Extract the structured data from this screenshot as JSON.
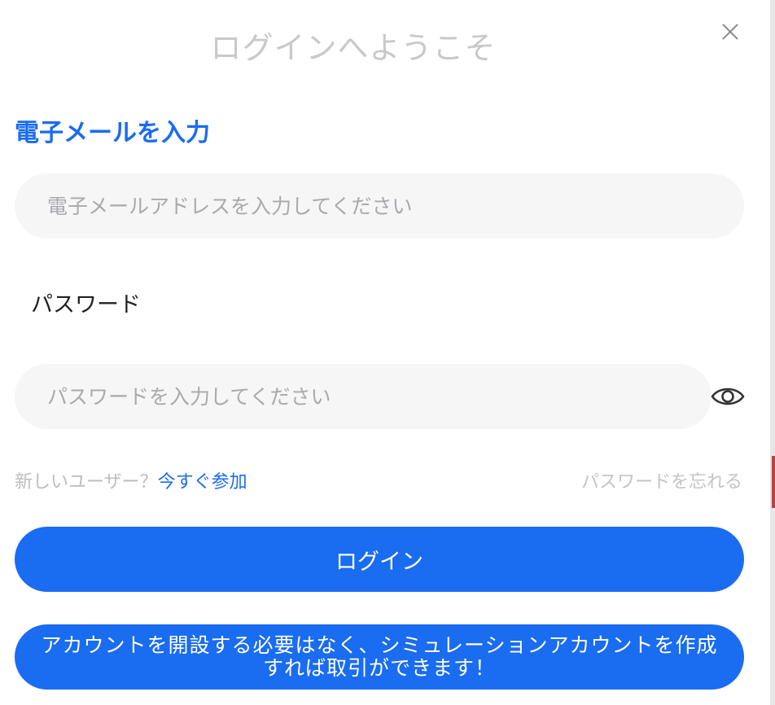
{
  "modal": {
    "title": "ログインへようこそ",
    "close_icon": "close-icon"
  },
  "email_section": {
    "heading": "電子メールを入力",
    "placeholder": "電子メールアドレスを入力してください",
    "value": ""
  },
  "password_section": {
    "label": "パスワード",
    "placeholder": "パスワードを入力してください",
    "value": "",
    "toggle_icon": "eye-icon"
  },
  "links": {
    "new_user_prompt": "新しいユーザー？",
    "join_now": "今すぐ参加",
    "forgot_password": "パスワードを忘れる"
  },
  "buttons": {
    "login": "ログイン",
    "simulation": "アカウントを開設する必要はなく、シミュレーションアカウントを作成すれば取引ができます！"
  },
  "colors": {
    "accent": "#1a6cf0",
    "title_gray": "#c9c9c9",
    "input_bg": "#f6f6f6"
  }
}
